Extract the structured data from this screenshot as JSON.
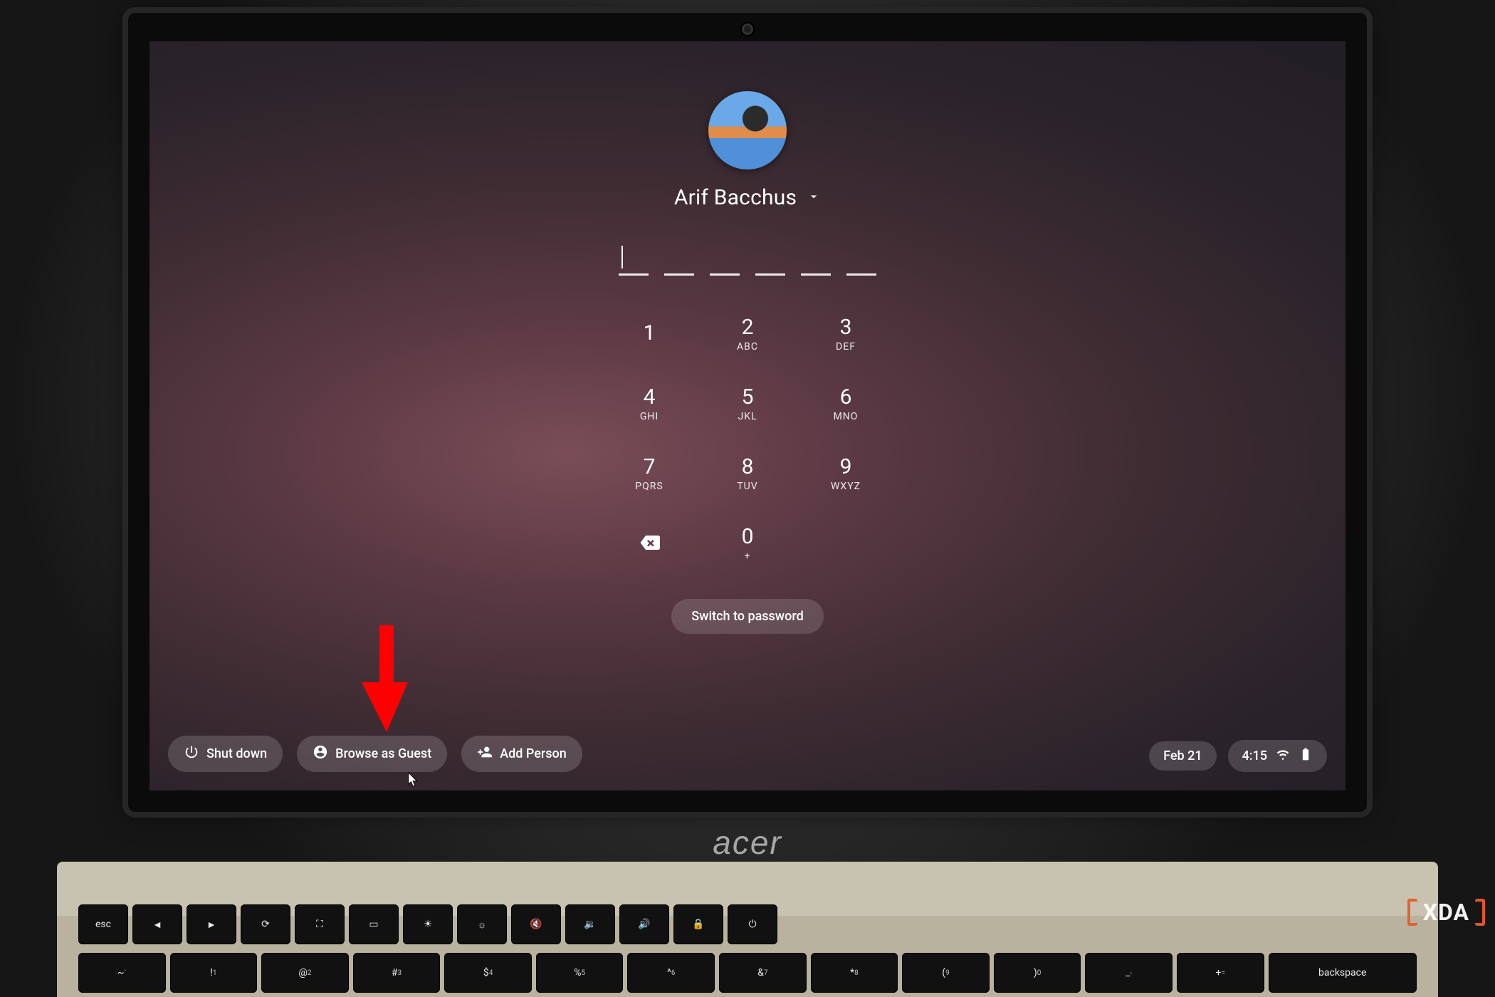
{
  "user": {
    "name": "Arif Bacchus"
  },
  "pin": {
    "length": 6
  },
  "keypad": {
    "keys": [
      {
        "digit": "1",
        "letters": ""
      },
      {
        "digit": "2",
        "letters": "ABC"
      },
      {
        "digit": "3",
        "letters": "DEF"
      },
      {
        "digit": "4",
        "letters": "GHI"
      },
      {
        "digit": "5",
        "letters": "JKL"
      },
      {
        "digit": "6",
        "letters": "MNO"
      },
      {
        "digit": "7",
        "letters": "PQRS"
      },
      {
        "digit": "8",
        "letters": "TUV"
      },
      {
        "digit": "9",
        "letters": "WXYZ"
      }
    ],
    "zero": {
      "digit": "0",
      "letters": "+"
    }
  },
  "switch_label": "Switch to password",
  "bottom": {
    "shutdown": "Shut down",
    "guest": "Browse as Guest",
    "add_person": "Add Person"
  },
  "status": {
    "date": "Feb 21",
    "time": "4:15"
  },
  "logo": "acer",
  "watermark": "XDA",
  "keyboard": {
    "row1": [
      "esc",
      "",
      "",
      "",
      "",
      "",
      "",
      "",
      "",
      "",
      "",
      "",
      ""
    ],
    "row2_right": "backspace"
  }
}
